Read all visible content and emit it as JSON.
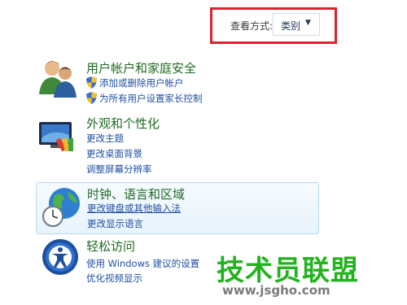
{
  "view_by": {
    "label": "查看方式:",
    "value": "类别"
  },
  "categories": [
    {
      "title": "用户帐户和家庭安全",
      "links": [
        "添加或删除用户帐户",
        "为所有用户设置家长控制"
      ]
    },
    {
      "title": "外观和个性化",
      "links": [
        "更改主题",
        "更改桌面背景",
        "调整屏幕分辨率"
      ]
    },
    {
      "title": "时钟、语言和区域",
      "links": [
        "更改键盘或其他输入法",
        "更改显示语言"
      ]
    },
    {
      "title": "轻松访问",
      "links": [
        "使用 Windows 建议的设置",
        "优化视频显示"
      ]
    }
  ],
  "watermark": {
    "text": "技术员联盟",
    "url": "www.jsgho.com"
  },
  "colors": {
    "highlight_border": "#d9232e",
    "title_green": "#1e6b22",
    "link_blue": "#1f4fa6"
  }
}
